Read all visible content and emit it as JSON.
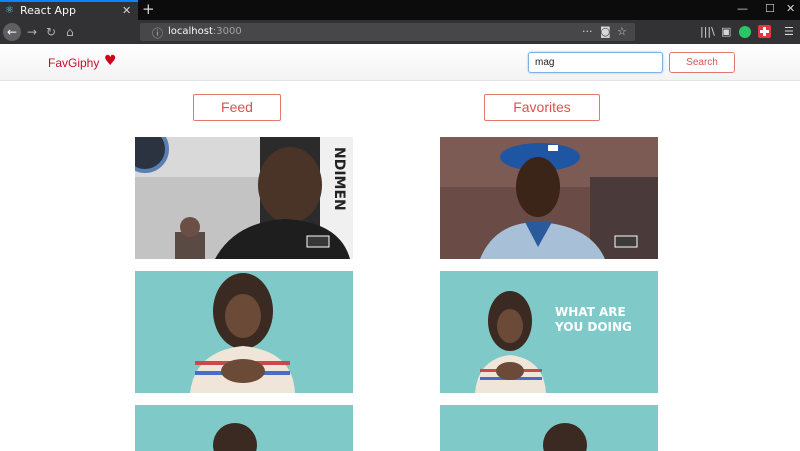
{
  "browser": {
    "tab_title": "React App",
    "url_host": "localhost",
    "url_port": ":3000"
  },
  "app": {
    "brand": "FavGiphy",
    "search": {
      "value": "mag",
      "placeholder": ""
    },
    "search_button": "Search",
    "tabs": {
      "feed": "Feed",
      "favorites": "Favorites"
    }
  },
  "gifs": {
    "feed": [
      {
        "subject": "laughing man in black jacket"
      },
      {
        "subject": "woman clutching chest on teal background"
      },
      {
        "subject": "woman on teal background"
      }
    ],
    "favorites": [
      {
        "subject": "baseball player in blue cap"
      },
      {
        "subject": "woman clutching chest on teal background",
        "caption": "WHAT ARE YOU DOING"
      },
      {
        "subject": "woman on teal background"
      }
    ]
  },
  "colors": {
    "brand": "#c8102e",
    "accent": "#d9534f",
    "teal": "#7fcac8"
  }
}
